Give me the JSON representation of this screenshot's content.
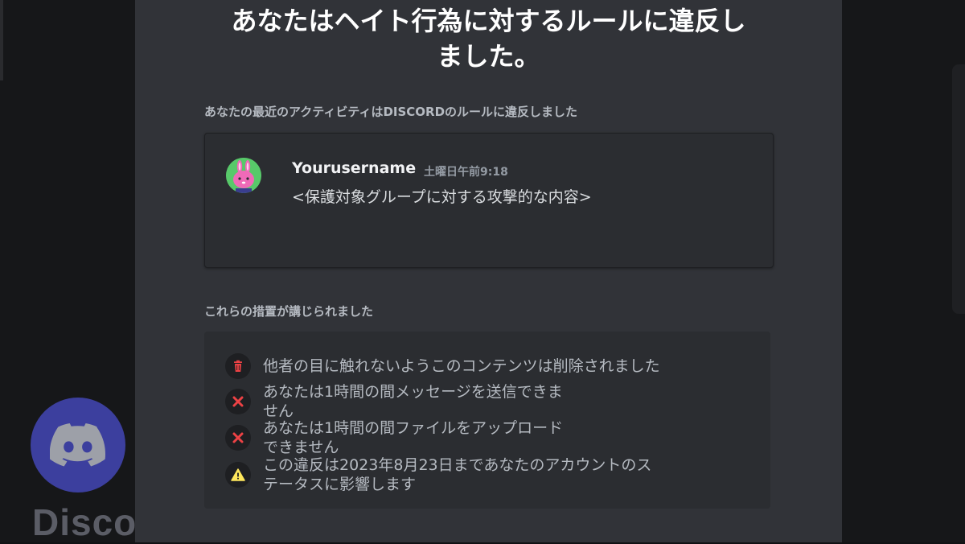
{
  "backdrop": {
    "wordmark": "Discor"
  },
  "modal": {
    "title_line1": "あなたはヘイト行為に対するルールに違反し",
    "title_line2": "ました。",
    "activity_label": "あなたの最近のアクティビティはDISCORDのルールに違反しました",
    "message": {
      "username": "Yourusername",
      "timestamp": "土曜日午前9:18",
      "text": "<保護対象グループに対する攻撃的な内容>"
    },
    "actions_label": "これらの措置が講じられました",
    "actions": [
      {
        "icon": "trash-icon",
        "line1": "他者の目に触れないようこのコンテンツは削除されました",
        "line2": ""
      },
      {
        "icon": "x-icon",
        "line1": "あなたは1時間の間メッセージを送信できま",
        "line2": "せん"
      },
      {
        "icon": "x-icon",
        "line1": "あなたは1時間の間ファイルをアップロード",
        "line2": "できません"
      },
      {
        "icon": "warning-icon",
        "line1": "この違反は2023年8月23日まであなたのアカウントのス",
        "line2": "テータスに影響します"
      }
    ]
  },
  "colors": {
    "modal_bg": "#313338",
    "card_bg": "#2b2d31",
    "danger": "#ed4245",
    "warning": "#fee75c",
    "discord_blurple_dim": "#3c3f9e"
  }
}
